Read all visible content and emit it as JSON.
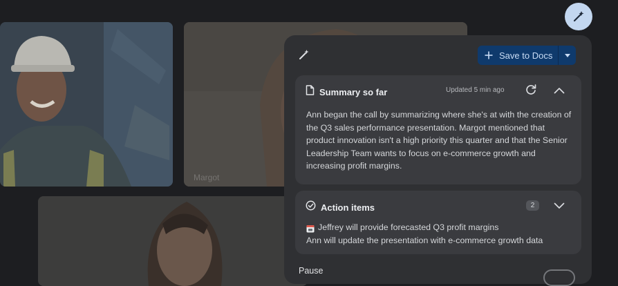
{
  "tiles": {
    "margot_name": "Margot"
  },
  "panel": {
    "save_button_label": "Save to Docs",
    "summary": {
      "title": "Summary so far",
      "updated": "Updated 5 min ago",
      "text": "Ann began the call by summarizing where she's at with the creation of the Q3 sales performance presentation. Margot mentioned that product innovation isn't a high priority this quarter and that the Senior Leadership Team wants to focus on e-commerce growth and increasing profit margins."
    },
    "action_items": {
      "title": "Action items",
      "count": "2",
      "items": [
        "Jeffrey will provide forecasted Q3 profit margins",
        "Ann will update the presentation with e-commerce growth data"
      ]
    },
    "pause_label": "Pause"
  },
  "icons": {
    "fab": "magic-wand-icon",
    "panel_header": "magic-wand-icon",
    "save": "plus-icon",
    "save_dropdown": "caret-down-icon",
    "summary": "document-icon",
    "refresh": "refresh-icon",
    "summary_toggle": "chevron-up-icon",
    "actions": "check-circle-icon",
    "actions_toggle": "chevron-down-icon",
    "action_item": "calendar-icon"
  },
  "colors": {
    "background": "#1d1e21",
    "panel": "#2f3033",
    "card": "#3a3b3f",
    "fab": "#c3d7f0",
    "save_button": "#0f3a6c",
    "save_text": "#c9dcf5"
  }
}
